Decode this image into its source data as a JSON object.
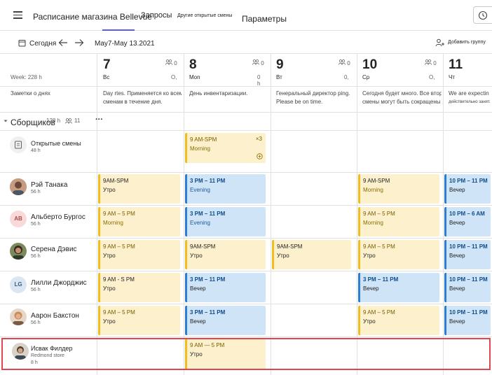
{
  "topbar": {
    "title": "Расписание магазина Bellevue",
    "tab_requests": "Запросы",
    "tab_open_shifts": "Другие открытые смены",
    "tab_settings": "Параметры"
  },
  "toolbar": {
    "today": "Сегодня",
    "date_range": "May7-May 13.2021",
    "add_group": "Добавить группу"
  },
  "header": {
    "week_hours": "Week: 228 h",
    "day_notes_label": "Заметки о днях",
    "days": [
      {
        "num": "7",
        "name": "Вс",
        "people": "0",
        "hours": "O,",
        "note1": "Day rtes. Применяется ко всем",
        "note2": "сменам в течение дня."
      },
      {
        "num": "8",
        "name": "Mon",
        "people": "0",
        "hours": "0 h",
        "note1": "День инвентаризации.",
        "note2": ""
      },
      {
        "num": "9",
        "name": "Вт",
        "people": "0",
        "hours": "0,",
        "note1": "Генеральный директор ping.",
        "note2": "Please be on time."
      },
      {
        "num": "10",
        "name": "Ср",
        "people": "0",
        "hours": "O,",
        "note1": "Сегодня будет много. Все вторые",
        "note2": "смены могут быть сокращены на"
      },
      {
        "num": "11",
        "name": "Чт",
        "people": "",
        "hours": "",
        "note1": "We are expectin",
        "note2": "действительно занят."
      }
    ]
  },
  "group": {
    "name": "Сборщиков",
    "hours": "128 h",
    "people": "11",
    "more": "···"
  },
  "open_shifts": {
    "label": "Открытые смены",
    "hours": "48 h",
    "shift": {
      "time": "9 AM-SPM",
      "label": "Morning",
      "count": "×3"
    }
  },
  "people": [
    {
      "name": "Рэй Танака",
      "hours": "56 h",
      "avatar": "photo"
    },
    {
      "name": "Альберто Бургос",
      "hours": "56 h",
      "avatar": "AB"
    },
    {
      "name": "Серена Дэвис",
      "hours": "56 h",
      "avatar": "photo"
    },
    {
      "name": "Лилли Джорджис",
      "hours": "56 h",
      "avatar": "LG"
    },
    {
      "name": "Аарон Бакстон",
      "hours": "56 h",
      "avatar": "photo"
    },
    {
      "name": "Исвак Филдер",
      "subtitle": "Redmond store",
      "hours": "8 h",
      "avatar": "photo"
    }
  ],
  "shifts": {
    "r0": [
      {
        "time": "9AM-SPM",
        "label": "Утро",
        "color": "yellow"
      },
      {
        "time": "3 PM – 11 PM",
        "label": "Evening",
        "color": "blue"
      },
      {
        "time": "9 AM-SPM",
        "label": "Morning",
        "color": "yellow"
      },
      {
        "time": "10 PM – 11 PM",
        "label": "Вечер",
        "color": "blue"
      }
    ],
    "r1": [
      {
        "time": "9 AM – 5 PM",
        "label": "Morning",
        "color": "yellow"
      },
      {
        "time": "3 PM – 11 PM",
        "label": "Evening",
        "color": "blue"
      },
      {
        "time": "9 AM – 5 PM",
        "label": "Morning",
        "color": "yellow"
      },
      {
        "time": "10 PM – 6 AM",
        "label": "Вечер",
        "color": "blue"
      }
    ],
    "r2": [
      {
        "time": "9 AM – 5 PM",
        "label": "Утро",
        "color": "yellow"
      },
      {
        "time": "9AM-SPM",
        "label": "Утро",
        "color": "yellow"
      },
      {
        "time": "9AM-SPM",
        "label": "Утро",
        "color": "yellow"
      },
      {
        "time": "9 AM – 5 PM",
        "label": "Утро",
        "color": "yellow"
      },
      {
        "time": "10 PM – 11 PM",
        "label": "Вечер",
        "color": "blue"
      }
    ],
    "r3": [
      {
        "time": "9 AM - S PM",
        "label": "Утро",
        "color": "yellow"
      },
      {
        "time": "3 PM – 11 PM",
        "label": "Вечер",
        "color": "blue"
      },
      {
        "time": "3 PM – 11 PM",
        "label": "Вечер",
        "color": "blue"
      },
      {
        "time": "10 PM – 11 PM",
        "label": "Вечер",
        "color": "blue"
      }
    ],
    "r4": [
      {
        "time": "9 AM – 5 PM",
        "label": "Утро",
        "color": "yellow"
      },
      {
        "time": "3 PM – 11 PM",
        "label": "Вечер",
        "color": "blue"
      },
      {
        "time": "9 AM – 5 PM",
        "label": "Утро",
        "color": "yellow"
      },
      {
        "time": "10 PM – 11 PM",
        "label": "Вечер",
        "color": "blue"
      }
    ],
    "r5": [
      {
        "time": "9 AM — 5 PM",
        "label": "Утро",
        "color": "yellow"
      }
    ]
  },
  "colors": {
    "accent": "#5b5fc7",
    "yellow_bar": "#f2bc1c",
    "blue_bar": "#2a7fd4",
    "highlight": "#e0464e"
  }
}
